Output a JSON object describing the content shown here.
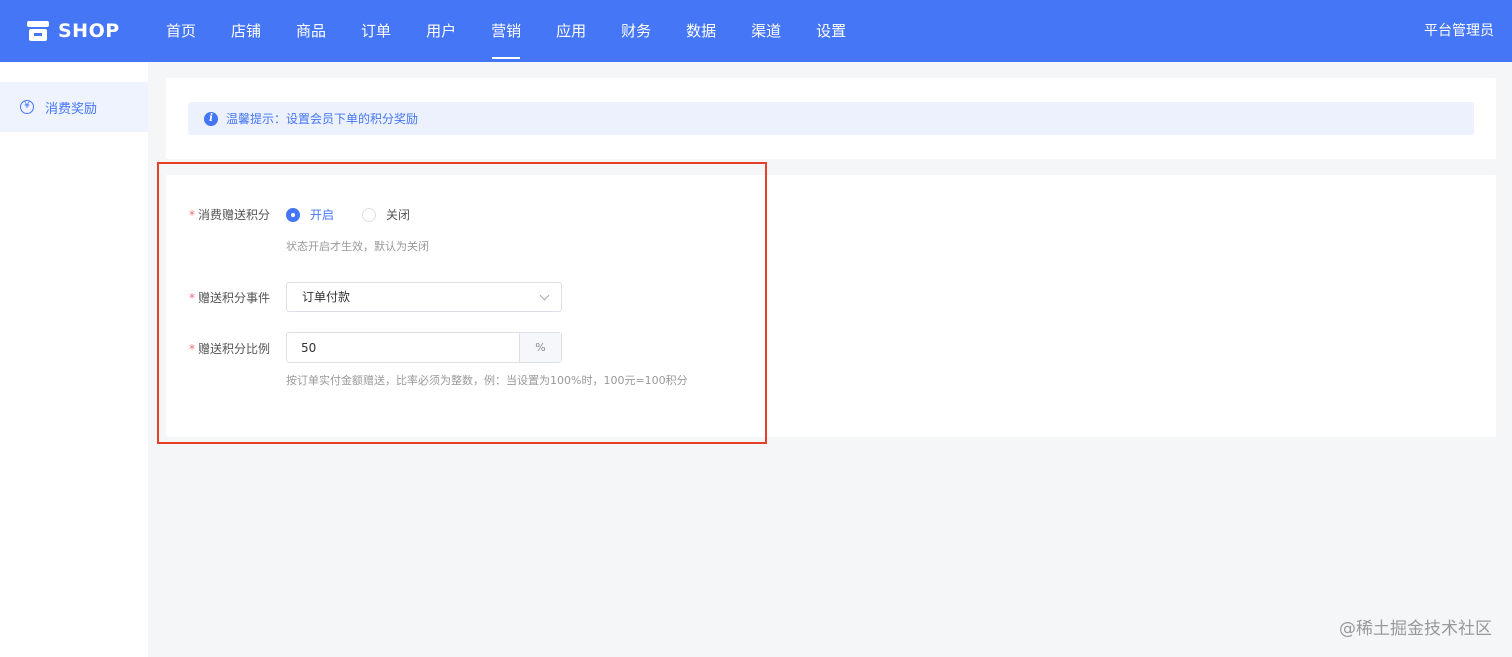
{
  "brand": {
    "name": "SHOP",
    "icon": "store-icon",
    "color": "#4576f5"
  },
  "nav": {
    "items": [
      "首页",
      "店铺",
      "商品",
      "订单",
      "用户",
      "营销",
      "应用",
      "财务",
      "数据",
      "渠道",
      "设置"
    ],
    "active": "营销"
  },
  "user": {
    "name": "平台管理员"
  },
  "sidebar": {
    "items": [
      {
        "label": "消费奖励",
        "icon": "yen-icon"
      }
    ]
  },
  "alert": {
    "icon": "info-icon",
    "text": "温馨提示：设置会员下单的积分奖励"
  },
  "form": {
    "reward_switch": {
      "label": "消费赠送积分",
      "options": [
        "开启",
        "关闭"
      ],
      "selected": "开启",
      "help": "状态开启才生效，默认为关闭"
    },
    "event": {
      "label": "赠送积分事件",
      "value": "订单付款"
    },
    "ratio": {
      "label": "赠送积分比例",
      "value": "50",
      "suffix": "%",
      "help": "按订单实付金额赠送，比率必须为整数，例：当设置为100%时，100元=100积分"
    },
    "required_mark": "*"
  },
  "watermark": "@稀土掘金技术社区",
  "colors": {
    "highlight_border": "#e6402b",
    "required": "#f56c6c"
  }
}
